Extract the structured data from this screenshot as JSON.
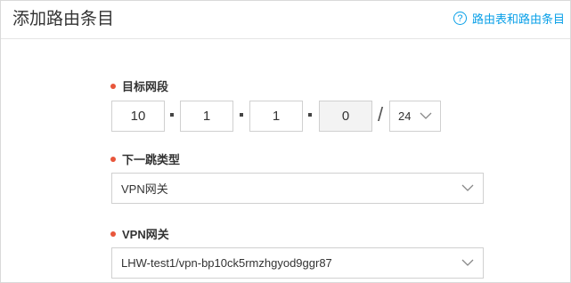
{
  "dialog": {
    "title": "添加路由条目",
    "help_link": "路由表和路由条目",
    "help_icon": "question-circle-icon"
  },
  "form": {
    "destination": {
      "label": "目标网段",
      "octets": [
        "10",
        "1",
        "1",
        "0"
      ],
      "mask": "24"
    },
    "next_hop_type": {
      "label": "下一跳类型",
      "value": "VPN网关"
    },
    "vpn_gateway": {
      "label": "VPN网关",
      "value": "LHW-test1/vpn-bp10ck5rmzhgyod9ggr87"
    }
  },
  "colors": {
    "accent": "#0aa0e8",
    "required_dot": "#e8563b",
    "border": "#d0d0d0"
  }
}
